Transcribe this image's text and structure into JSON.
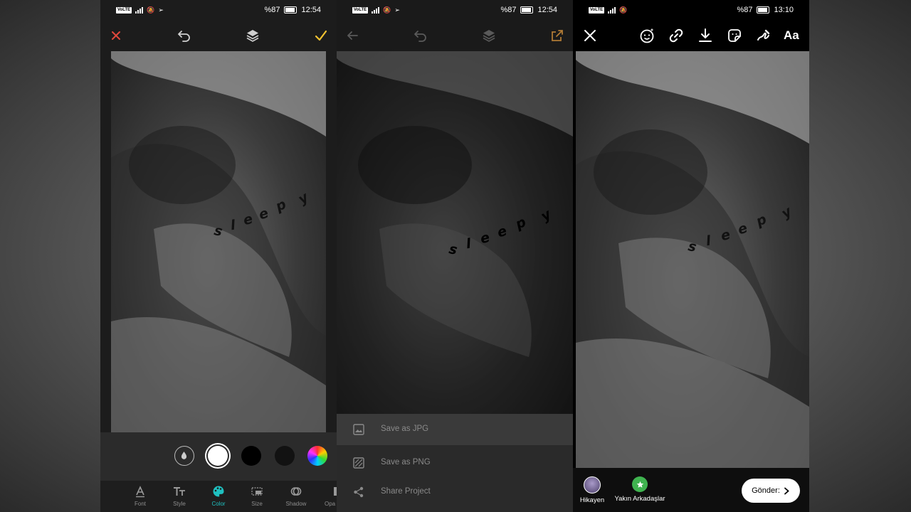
{
  "screens": [
    {
      "status": {
        "battery": "%87",
        "time": "12:54"
      },
      "toolbar": {
        "close_icon": "close-icon",
        "undo_icon": "undo-icon",
        "layers_icon": "layers-icon",
        "confirm_icon": "check-icon"
      },
      "sticker": [
        "s",
        "l",
        "e",
        "e",
        "p",
        "y"
      ],
      "colors": {
        "accent_close": "#e0483c",
        "accent_confirm": "#f2c230",
        "accent_active": "#1fc0c0"
      },
      "swatches": [
        "eyedropper",
        "#ffffff",
        "#000000",
        "#121212",
        "spectrum"
      ],
      "tabs": [
        {
          "label": "Font",
          "icon": "font-icon"
        },
        {
          "label": "Style",
          "icon": "text-style-icon"
        },
        {
          "label": "Color",
          "icon": "palette-icon",
          "active": true
        },
        {
          "label": "Size",
          "icon": "size-icon"
        },
        {
          "label": "Shadow",
          "icon": "shadow-icon"
        },
        {
          "label": "Opa",
          "icon": "opacity-icon"
        }
      ]
    },
    {
      "status": {
        "battery": "%87",
        "time": "12:54"
      },
      "sticker": [
        "s",
        "l",
        "e",
        "e",
        "p",
        "y"
      ],
      "menu": [
        {
          "label": "Save as JPG",
          "icon": "image-icon"
        },
        {
          "label": "Save as PNG",
          "icon": "image-transparent-icon"
        },
        {
          "label": "Share Project",
          "icon": "share-icon"
        }
      ]
    },
    {
      "status": {
        "battery": "%87",
        "time": "13:10"
      },
      "sticker": [
        "s",
        "l",
        "e",
        "e",
        "p",
        "y"
      ],
      "toolbar": {
        "text_tool": "Aa"
      },
      "targets": [
        {
          "label": "Hikayen",
          "icon": "avatar"
        },
        {
          "label": "Yakın Arkadaşlar",
          "icon": "star-icon"
        }
      ],
      "send_label": "Gönder:"
    }
  ]
}
